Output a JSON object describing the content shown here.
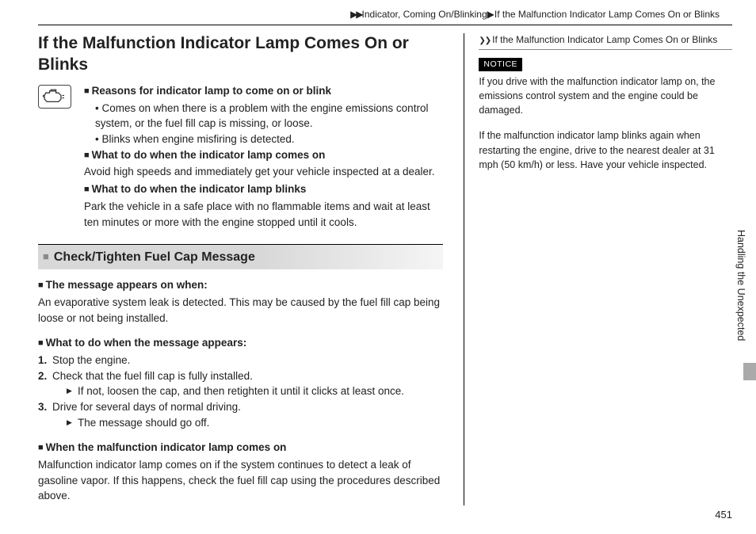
{
  "breadcrumb": {
    "segment1": "Indicator, Coming On/Blinking",
    "segment2": "If the Malfunction Indicator Lamp Comes On or Blinks"
  },
  "title": "If the Malfunction Indicator Lamp Comes On or Blinks",
  "left": {
    "h_reasons": "Reasons for indicator lamp to come on or blink",
    "bullet1": "Comes on when there is a problem with the engine emissions control system, or the fuel fill cap is missing, or loose.",
    "bullet2": "Blinks when engine misfiring is detected.",
    "h_comes_on": "What to do when the indicator lamp comes on",
    "comes_on_body": "Avoid high speeds and immediately get your vehicle inspected at a dealer.",
    "h_blinks": "What to do when the indicator lamp blinks",
    "blinks_body": "Park the vehicle in a safe place with no flammable items and wait at least ten minutes or more with the engine stopped until it cools.",
    "section_bar": "Check/Tighten Fuel Cap Message",
    "h_appears": "The message appears on when:",
    "appears_body": "An evaporative system leak is detected. This may be caused by the fuel fill cap being loose or not being installed.",
    "h_what_to_do": "What to do when the message appears:",
    "step1": "Stop the engine.",
    "step2": "Check that the fuel fill cap is fully installed.",
    "step2_sub": "If not, loosen the cap, and then retighten it until it clicks at least once.",
    "step3": "Drive for several days of normal driving.",
    "step3_sub": "The message should go off.",
    "h_when_lamp": "When the malfunction indicator lamp comes on",
    "when_lamp_body": "Malfunction indicator lamp comes on if the system continues to detect a leak of gasoline vapor. If this happens, check the fuel fill cap using the procedures described above."
  },
  "right": {
    "side_title": "If the Malfunction Indicator Lamp Comes On or Blinks",
    "notice_label": "NOTICE",
    "notice_body": "If you drive with the malfunction indicator lamp on, the emissions control system and the engine could be damaged.",
    "para2": "If the malfunction indicator lamp blinks again when restarting the engine, drive to the nearest dealer at 31 mph (50 km/h) or less. Have your vehicle inspected."
  },
  "tab_label": "Handling the Unexpected",
  "page_number": "451"
}
